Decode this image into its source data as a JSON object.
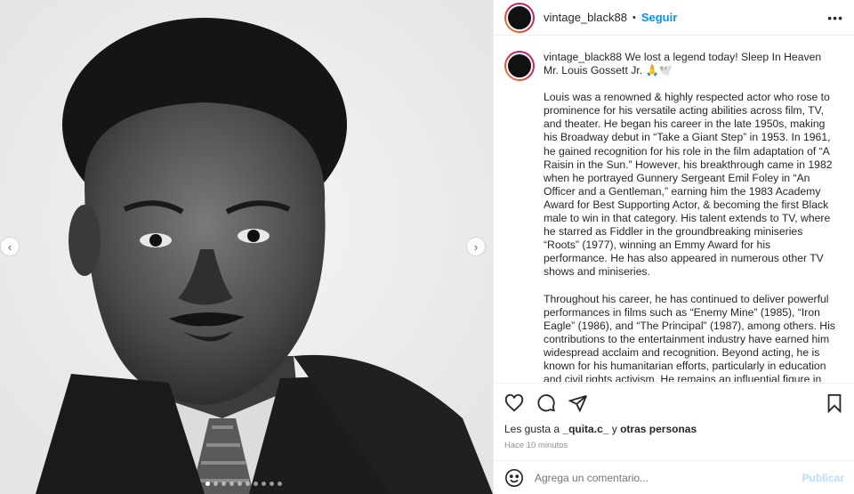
{
  "media": {
    "prev_icon": "chevron-left-icon",
    "next_icon": "chevron-right-icon",
    "prev_glyph": "‹",
    "next_glyph": "›",
    "slide_count": 10,
    "active_slide": 1
  },
  "header": {
    "username": "vintage_black88",
    "separator": "•",
    "follow_label": "Seguir",
    "more_label": "•••"
  },
  "caption": {
    "username": "vintage_black88",
    "lead": " We lost a legend today! Sleep In Heaven Mr. Louis Gossett Jr. 🙏🕊️",
    "paragraph_1": "Louis was a renowned & highly respected actor who rose to prominence for his versatile acting abilities across film, TV, and theater. He began his career in the late 1950s, making his Broadway debut in “Take a Giant Step” in 1953. In 1961, he gained recognition for his role in the film adaptation of “A Raisin in the Sun.” However, his breakthrough came in 1982 when he portrayed Gunnery Sergeant Emil Foley in “An Officer and a Gentleman,” earning him the 1983 Academy Award for Best Supporting Actor, & becoming the first Black male to win in that category. His talent extends to TV, where he starred as Fiddler in the groundbreaking miniseries “Roots” (1977), winning an Emmy Award for his performance. He has also appeared in numerous other TV shows and miniseries.",
    "paragraph_2": "Throughout his career, he has continued to deliver powerful performances in films such as “Enemy Mine” (1985), “Iron Eagle” (1986), and “The Principal” (1987), among others. His contributions to the entertainment industry have earned him widespread acclaim and recognition. Beyond acting, he is known for his humanitarian efforts, particularly in education and civil rights activism. He remains an influential figure in both the entertainment industry and social advocacy."
  },
  "actions": {
    "like_icon": "heart-icon",
    "comment_icon": "comment-icon",
    "share_icon": "share-icon",
    "save_icon": "bookmark-icon",
    "likes_prefix": "Les gusta a ",
    "likes_user": "_quita.c_",
    "likes_middle": " y ",
    "likes_suffix": "otras personas",
    "time_ago": "Hace 10 minutos"
  },
  "comment_box": {
    "emoji_icon": "smiley-icon",
    "placeholder": "Agrega un comentario...",
    "post_label": "Publicar"
  },
  "colors": {
    "accent": "#0095f6",
    "post_disabled": "#b2dffc",
    "muted": "#8e8e8e"
  }
}
